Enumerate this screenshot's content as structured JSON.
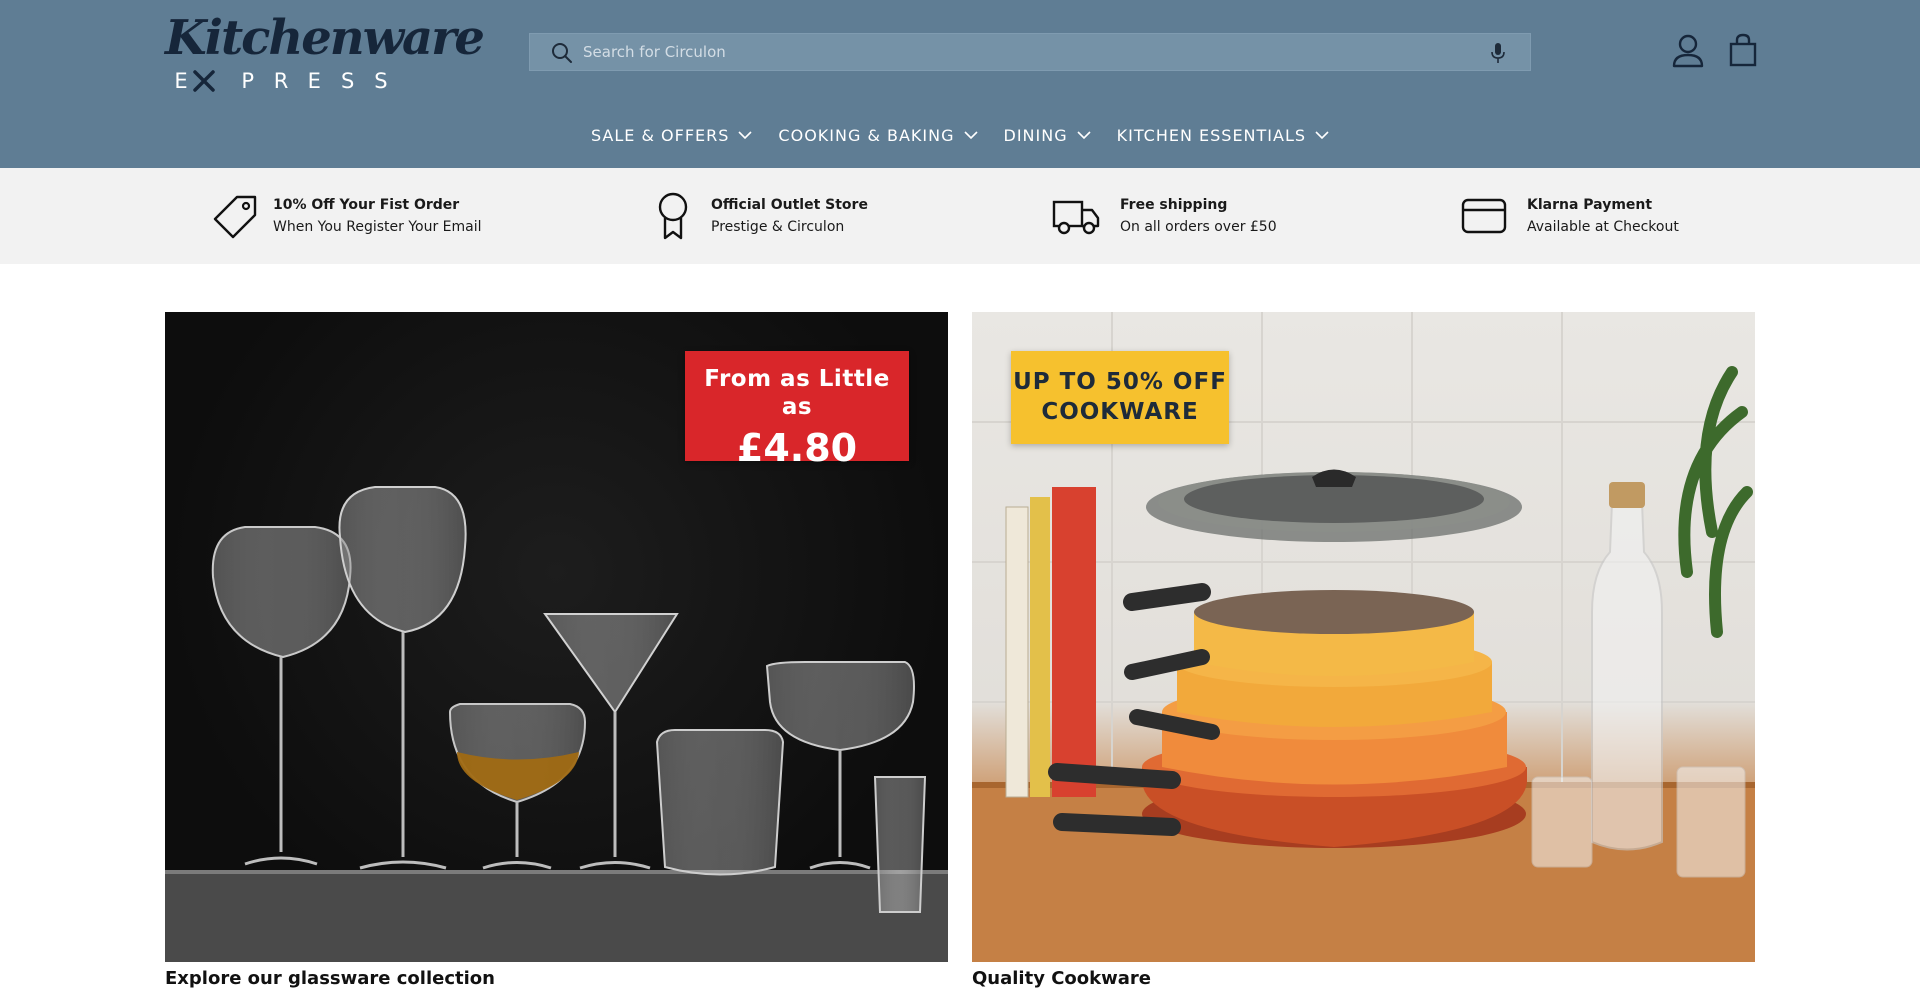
{
  "brand": {
    "name": "Kitchenware",
    "subtitle_letters": [
      "E",
      "X",
      "P",
      "R",
      "E",
      "S",
      "S"
    ]
  },
  "search": {
    "placeholder": "Search for Circulon",
    "value": ""
  },
  "header_icons": {
    "search": "search-icon",
    "voice": "microphone-icon",
    "account": "user-icon",
    "cart": "shopping-bag-icon"
  },
  "nav": {
    "items": [
      {
        "label": "SALE & OFFERS"
      },
      {
        "label": "COOKING & BAKING"
      },
      {
        "label": "DINING"
      },
      {
        "label": "KITCHEN ESSENTIALS"
      }
    ]
  },
  "usps": [
    {
      "icon": "price-tag-icon",
      "title": "10% Off Your Fist Order",
      "subtitle": "When You Register Your Email"
    },
    {
      "icon": "award-ribbon-icon",
      "title": "Official Outlet Store",
      "subtitle": "Prestige & Circulon"
    },
    {
      "icon": "delivery-truck-icon",
      "title": "Free shipping",
      "subtitle": "On all orders over £50"
    },
    {
      "icon": "credit-card-icon",
      "title": "Klarna Payment",
      "subtitle": "Available at Checkout"
    }
  ],
  "promos": [
    {
      "badge_line1": "From as Little as",
      "badge_line2": "£4.80",
      "caption": "Explore our glassware collection"
    },
    {
      "badge_line1": "UP TO 50% OFF",
      "badge_line2": "COOKWARE",
      "caption": "Quality Cookware"
    }
  ],
  "colors": {
    "header_bg": "#5f7d94",
    "search_bg": "#7592a7",
    "usp_bg": "#f2f2f2",
    "badge_red": "#d9262a",
    "badge_yellow": "#f6c12e",
    "logo_dark": "#16263a"
  }
}
